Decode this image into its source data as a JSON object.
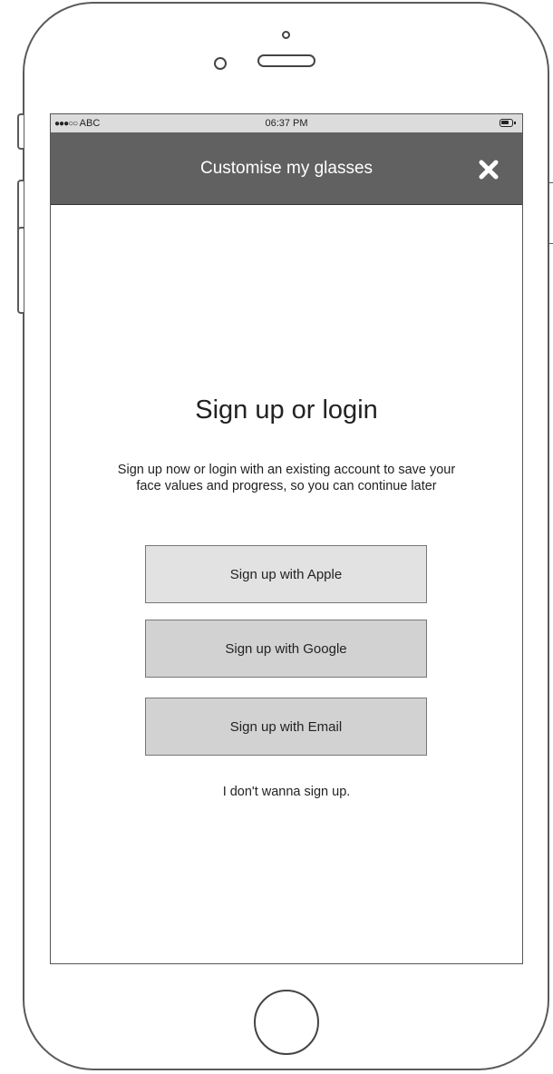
{
  "status_bar": {
    "signal": "●●●○○",
    "carrier": "ABC",
    "time": "06:37 PM",
    "battery_icon": "battery-icon"
  },
  "nav": {
    "title": "Customise my glasses",
    "close_icon": "close-icon"
  },
  "main": {
    "heading": "Sign up or login",
    "subtext": "Sign up now or login with an existing account to save your face values and progress, so you can continue later",
    "buttons": {
      "apple": "Sign up with Apple",
      "google": "Sign up with Google",
      "email": "Sign up with Email"
    },
    "skip_link": "I don't wanna sign up."
  },
  "colors": {
    "nav_background": "#616161",
    "status_background": "#dcdcdc",
    "apple_button": "#e2e2e2",
    "secondary_buttons": "#d2d2d2"
  }
}
